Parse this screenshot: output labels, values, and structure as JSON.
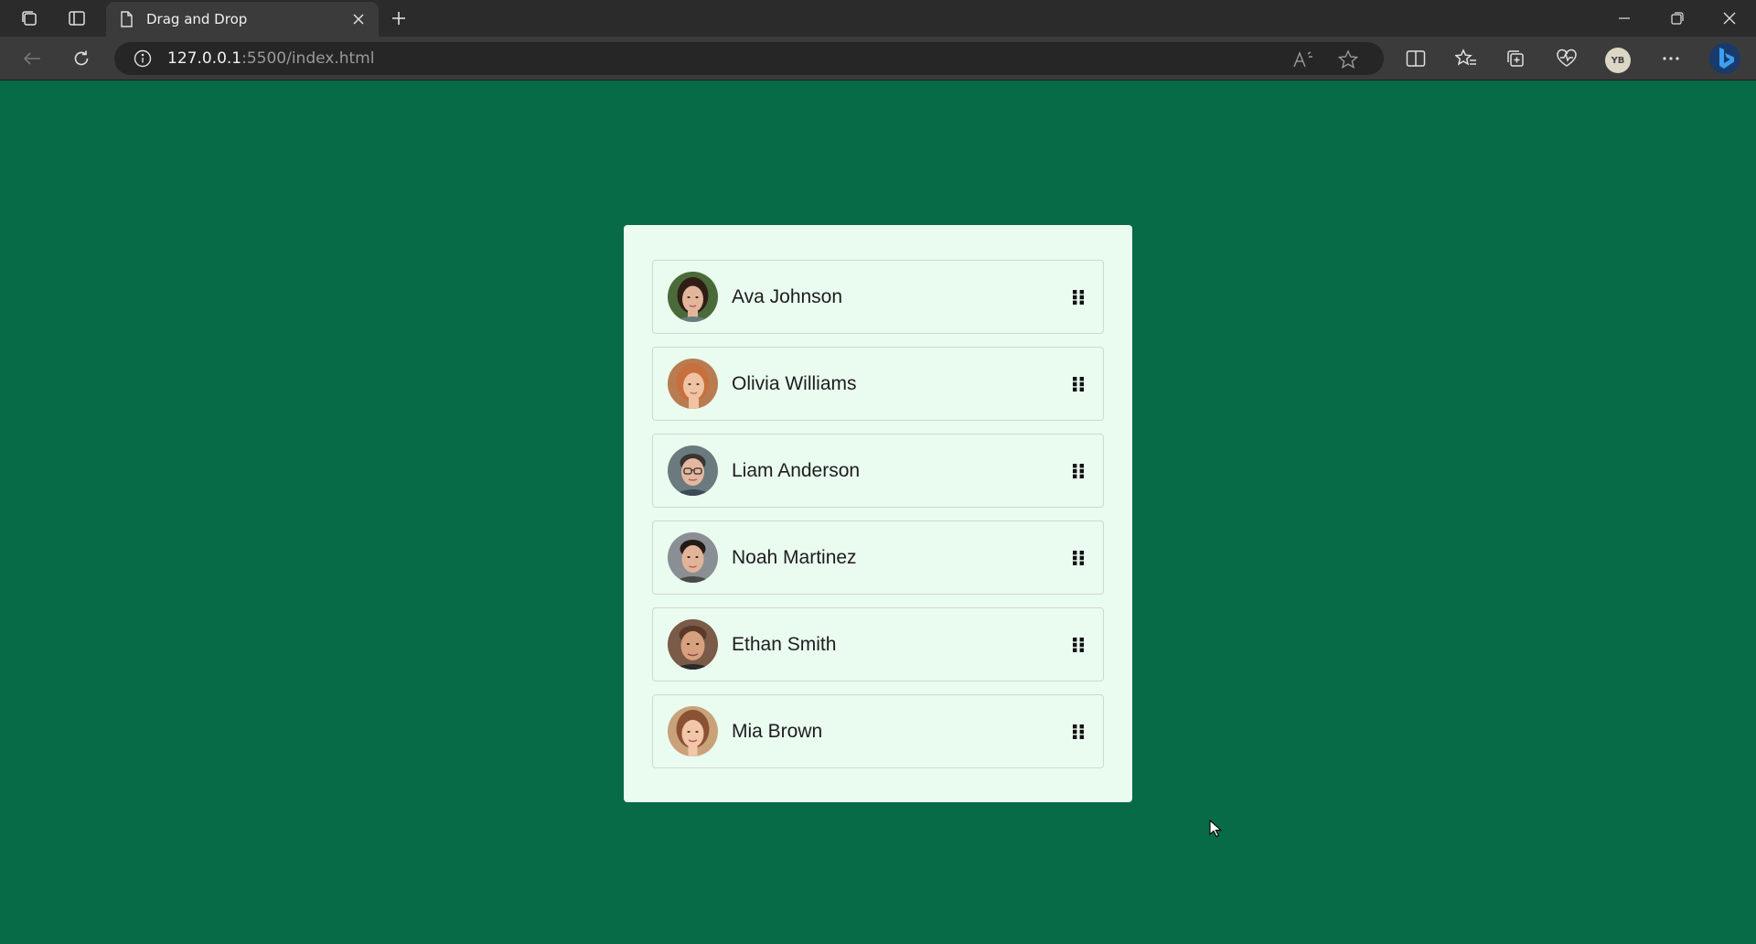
{
  "browser": {
    "tab_title": "Drag and Drop",
    "url_host": "127.0.0.1",
    "url_rest": ":5500/index.html",
    "profile_initials": "YB"
  },
  "list": {
    "items": [
      {
        "name": "Ava Johnson",
        "avatar": "woman-dark-hair"
      },
      {
        "name": "Olivia Williams",
        "avatar": "woman-red-hair"
      },
      {
        "name": "Liam Anderson",
        "avatar": "man-glasses"
      },
      {
        "name": "Noah Martinez",
        "avatar": "man-dark-hair"
      },
      {
        "name": "Ethan Smith",
        "avatar": "man-brown-hair"
      },
      {
        "name": "Mia Brown",
        "avatar": "woman-brown-hair"
      }
    ]
  },
  "colors": {
    "page_background": "#086b47",
    "card_background": "#eafbef",
    "item_border": "#cfd8d2",
    "text": "#1d1d1d"
  }
}
